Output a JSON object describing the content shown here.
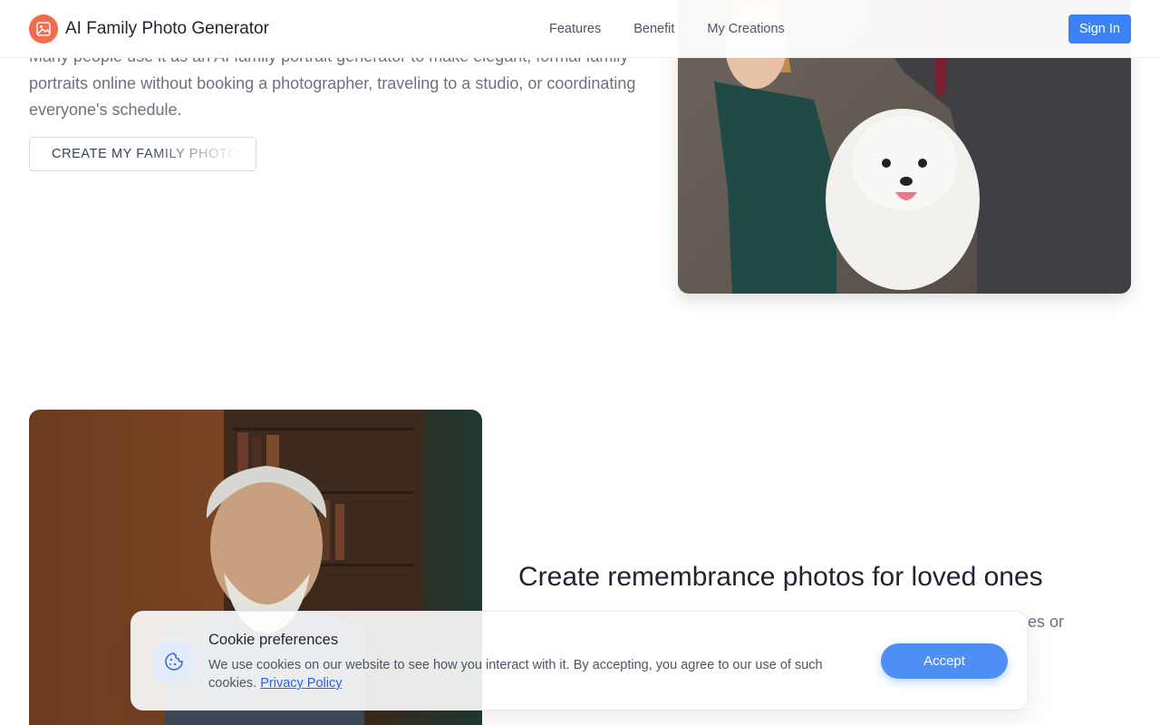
{
  "header": {
    "brand": "AI Family Photo Generator",
    "nav": [
      "Features",
      "Benefit",
      "My Creations"
    ],
    "signin": "Sign In"
  },
  "section1": {
    "text": "Many people use it as an AI family portrait generator to make elegant, formal family portraits online without booking a photographer, traveling to a studio, or coordinating everyone's schedule.",
    "cta": "CREATE MY FAMILY PHOTO"
  },
  "section2": {
    "title": "Create remembrance photos for loved ones",
    "peek": "es or"
  },
  "cookie": {
    "title": "Cookie preferences",
    "text": "We use cookies on our website to see how you interact with it. By accepting, you agree to our use of such cookies.",
    "link": "Privacy Policy",
    "accept": "Accept"
  },
  "colors": {
    "accent": "#3b82f6",
    "logo": "#f26b4a",
    "accept": "#4d8ff5"
  }
}
